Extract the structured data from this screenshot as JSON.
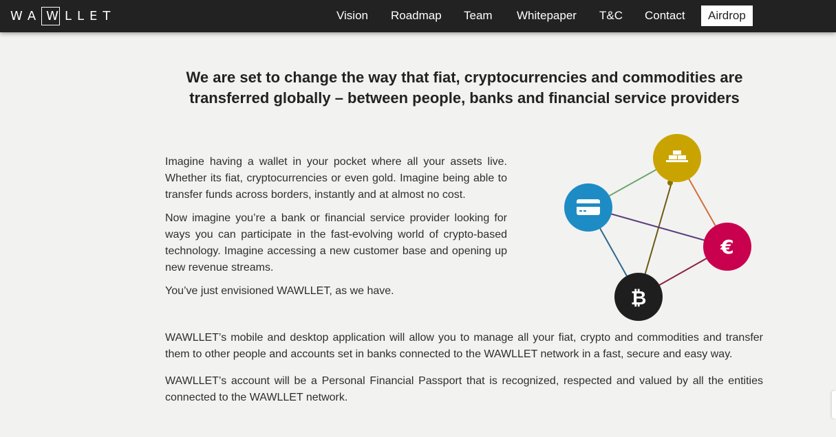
{
  "brand": {
    "logo_text_left": "WA",
    "logo_text_box": "W",
    "logo_text_right": "LLET"
  },
  "nav": {
    "items": [
      {
        "label": "Vision"
      },
      {
        "label": "Roadmap"
      },
      {
        "label": "Team"
      },
      {
        "label": "Whitepaper"
      },
      {
        "label": "T&C"
      },
      {
        "label": "Contact"
      },
      {
        "label": "Airdrop",
        "active": true
      }
    ]
  },
  "hero": {
    "headline_line1": "We are set to change the way that fiat, cryptocurrencies and commodities are",
    "headline_line2": "transferred globally – between people, banks and financial service providers"
  },
  "intro": {
    "p1": "Imagine having a wallet in your pocket where all your assets live. Whether its fiat, cryptocurrencies or even gold. Imagine being able to transfer funds across borders, instantly and at almost no cost.",
    "p2": "Now imagine you’re a bank or financial service provider looking for ways you can participate in the fast-evolving world of crypto-based technology. Imagine accessing a new customer base and opening up new revenue streams.",
    "p3": "You’ve just envisioned WAWLLET, as we have."
  },
  "network": {
    "nodes": [
      {
        "name": "gold-icon",
        "color": "#c9a400"
      },
      {
        "name": "credit-card-icon",
        "color": "#1d8cc4"
      },
      {
        "name": "euro-icon",
        "color": "#c8004e",
        "glyph": "€"
      },
      {
        "name": "bitcoin-icon",
        "color": "#1e1e1e",
        "glyph": "₿"
      }
    ]
  },
  "body": {
    "p1": "WAWLLET’s mobile and desktop application will allow you to manage all your fiat, crypto and commodities and transfer them to other people and accounts set in banks connected to the WAWLLET network in a fast, secure and easy way.",
    "p2": "WAWLLET’s account will be a Personal Financial Passport that is recognized, respected and valued by all the entities connected to the WAWLLET network."
  }
}
